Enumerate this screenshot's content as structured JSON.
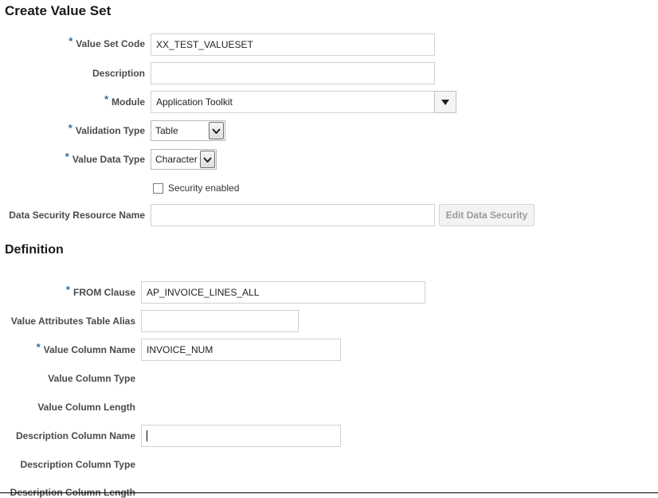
{
  "page_title": "Create Value Set",
  "fields": {
    "value_set_code": {
      "label": "Value Set Code",
      "required": "*",
      "value": "XX_TEST_VALUESET"
    },
    "description": {
      "label": "Description",
      "value": ""
    },
    "module": {
      "label": "Module",
      "required": "*",
      "value": "Application Toolkit"
    },
    "validation_type": {
      "label": "Validation Type",
      "required": "*",
      "value": "Table"
    },
    "value_data_type": {
      "label": "Value Data Type",
      "required": "*",
      "value": "Character"
    },
    "security_enabled": {
      "label": "Security enabled",
      "checked": false
    },
    "data_security_resource_name": {
      "label": "Data Security Resource Name",
      "value": ""
    },
    "edit_data_security_button": "Edit Data Security"
  },
  "definition": {
    "heading": "Definition",
    "from_clause": {
      "label": "FROM Clause",
      "required": "*",
      "value": "AP_INVOICE_LINES_ALL"
    },
    "value_attributes_table_alias": {
      "label": "Value Attributes Table Alias",
      "value": ""
    },
    "value_column_name": {
      "label": "Value Column Name",
      "required": "*",
      "value": "INVOICE_NUM"
    },
    "value_column_type": {
      "label": "Value Column Type"
    },
    "value_column_length": {
      "label": "Value Column Length"
    },
    "description_column_name": {
      "label": "Description Column Name",
      "value": ""
    },
    "description_column_type": {
      "label": "Description Column Type"
    },
    "description_column_length": {
      "label": "Description Column Length"
    }
  },
  "colors": {
    "required_star": "#2a6fa8",
    "input_border": "#c9d3dc",
    "disabled_button_text": "#9a9a9a"
  }
}
